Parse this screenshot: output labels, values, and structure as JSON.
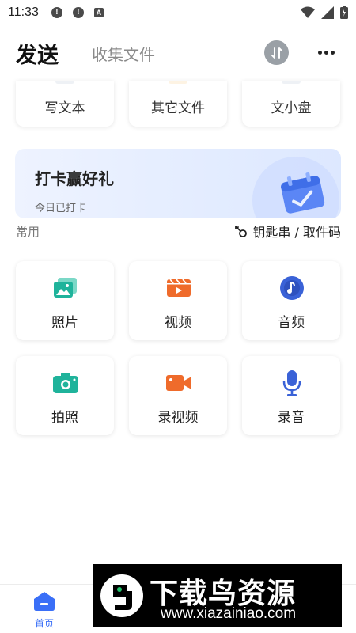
{
  "status_bar": {
    "time": "11:33",
    "icons": [
      "alert-icon",
      "alert-icon",
      "a-box-icon"
    ],
    "icon_glyphs": [
      "!",
      "!",
      "A"
    ],
    "right_icons": [
      "wifi-icon",
      "signal-icon",
      "battery-icon"
    ]
  },
  "header": {
    "active_tab": "发送",
    "inactive_tab": "收集文件",
    "sort_icon": "transfer-sort-icon",
    "more_icon": "more-horizontal-icon"
  },
  "top_cards": [
    {
      "label": "写文本"
    },
    {
      "label": "其它文件"
    },
    {
      "label": "文小盘"
    }
  ],
  "banner": {
    "title": "打卡赢好礼",
    "subtitle": "今日已打卡",
    "icon": "calendar-check-icon"
  },
  "section": {
    "label": "常用",
    "link_label": "钥匙串 / 取件码",
    "link_icon": "key-icon"
  },
  "grid": [
    {
      "label": "照片",
      "icon": "photo-icon",
      "color": "#1fb39b"
    },
    {
      "label": "视频",
      "icon": "video-icon",
      "color": "#ef6b2b"
    },
    {
      "label": "音频",
      "icon": "music-note-icon",
      "color": "#3a62d7"
    },
    {
      "label": "拍照",
      "icon": "camera-icon",
      "color": "#1fb39b"
    },
    {
      "label": "录视频",
      "icon": "video-camera-icon",
      "color": "#ef6b2b"
    },
    {
      "label": "录音",
      "icon": "microphone-icon",
      "color": "#3a62d7"
    }
  ],
  "bottom_nav": {
    "home_label": "首页",
    "home_icon": "home-icon",
    "accent": "#3a6ff7"
  },
  "watermark": {
    "title": "下载鸟资源",
    "url": "www.xiazainiao.com"
  }
}
